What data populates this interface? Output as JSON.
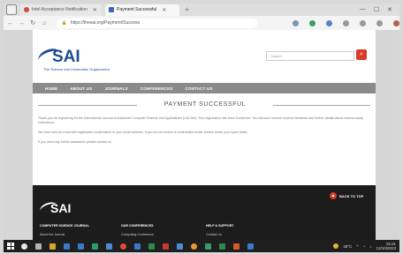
{
  "browser": {
    "tabs": [
      {
        "label": "Intel Acceptance Notification",
        "active": false
      },
      {
        "label": "Payment Successful",
        "active": true
      }
    ],
    "address": "https://thesai.org/Payment/Success"
  },
  "site": {
    "logo_name": "SAI",
    "logo_tagline": "The Science and Information Organization",
    "search_placeholder": "Search",
    "nav": [
      "HOME",
      "ABOUT US",
      "JOURNALS",
      "CONFERENCES",
      "CONTACT US"
    ]
  },
  "content": {
    "title": "PAYMENT SUCCESSFUL",
    "paragraphs": [
      "Thank you for registering for the International Journal of Advanced Computer Science and Applications (IJACSA). Your registration has been Confirmed. You will soon receive invoices feedback and further details about camera ready submission.",
      "We have sent an email with registration confirmation to your email address. If you do not receive a confirmation email, please check your spam folder.",
      "If you need any further assistance please contact us."
    ]
  },
  "footer": {
    "back_to_top": "BACK TO TOP",
    "logo_name": "SAI",
    "columns": [
      {
        "heading": "COMPUTER SCIENCE JOURNAL",
        "link": "About the Journal"
      },
      {
        "heading": "OUR CONFERENCES",
        "link": "Computing Conference"
      },
      {
        "heading": "HELP & SUPPORT",
        "link": "Contact Us"
      }
    ]
  },
  "taskbar": {
    "temperature": "28°C",
    "time": "15:21",
    "date": "12/10/2023"
  }
}
